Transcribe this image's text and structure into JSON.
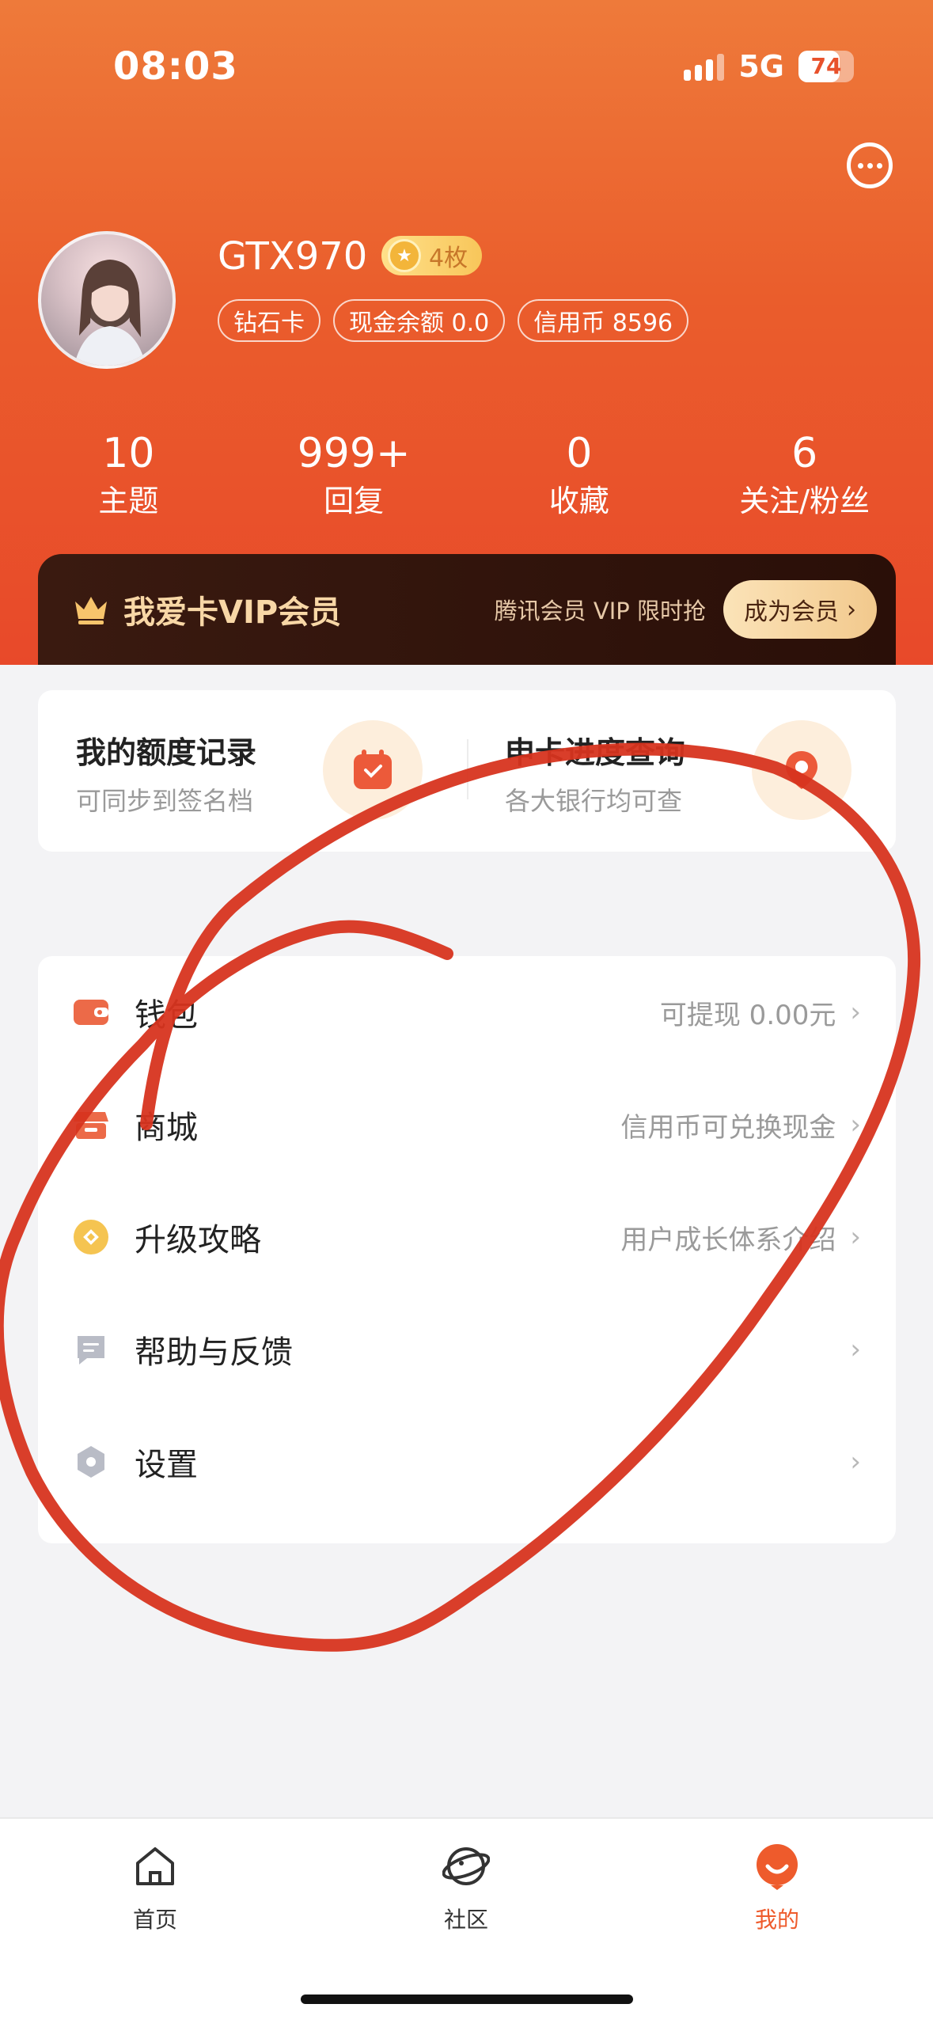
{
  "status_bar": {
    "time": "08:03",
    "network": "5G",
    "battery": "74",
    "battery_level_percent": 74
  },
  "profile": {
    "username": "GTX970",
    "coin_badge": "4枚",
    "tags": [
      "钻石卡",
      "现金余额 0.0",
      "信用币 8596"
    ]
  },
  "stats": [
    {
      "num": "10",
      "label": "主题"
    },
    {
      "num": "999+",
      "label": "回复"
    },
    {
      "num": "0",
      "label": "收藏"
    },
    {
      "num": "6",
      "label": "关注/粉丝"
    }
  ],
  "vip": {
    "title": "我爱卡VIP会员",
    "subtitle": "腾讯会员 VIP 限时抢",
    "button": "成为会员"
  },
  "quick": [
    {
      "title": "我的额度记录",
      "sub": "可同步到签名档"
    },
    {
      "title": "申卡进度查询",
      "sub": "各大银行均可查"
    }
  ],
  "menu": [
    {
      "label": "钱包",
      "value": "可提现 0.00元",
      "icon": "wallet-icon",
      "color": "#ec6a48"
    },
    {
      "label": "商城",
      "value": "信用币可兑换现金",
      "icon": "store-icon",
      "color": "#ec6a48"
    },
    {
      "label": "升级攻略",
      "value": "用户成长体系介绍",
      "icon": "upgrade-icon",
      "color": "#f5c451"
    },
    {
      "label": "帮助与反馈",
      "value": "",
      "icon": "feedback-icon",
      "color": "#b9bcc6"
    },
    {
      "label": "设置",
      "value": "",
      "icon": "settings-icon",
      "color": "#b9bcc6"
    }
  ],
  "tabs": [
    {
      "label": "首页",
      "icon": "home-icon"
    },
    {
      "label": "社区",
      "icon": "community-icon"
    },
    {
      "label": "我的",
      "icon": "profile-icon"
    }
  ],
  "colors": {
    "accent": "#ee5b2c",
    "vip_gold": "#f8d7a6",
    "scribble": "#d7341f"
  }
}
